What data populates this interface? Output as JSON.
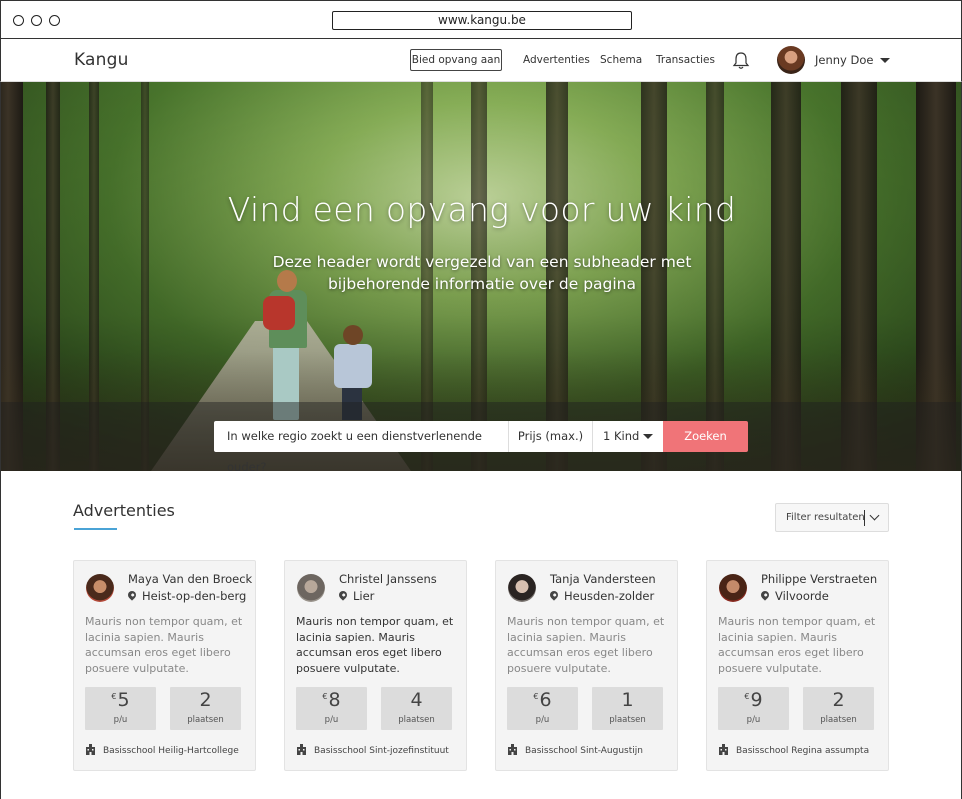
{
  "browser": {
    "url": "www.kangu.be"
  },
  "nav": {
    "logo": "Kangu",
    "offer_button": "Bied opvang aan",
    "links": [
      "Advertenties",
      "Schema",
      "Transacties"
    ],
    "user_name": "Jenny Doe"
  },
  "hero": {
    "title": "Vind een opvang voor uw kind",
    "subtitle_line1": "Deze header wordt vergezeld van een subheader met",
    "subtitle_line2": "bijbehorende informatie over de pagina"
  },
  "search": {
    "region_placeholder": "In welke regio zoekt u een dienstverlenende ouder?",
    "price_label": "Prijs (max.)",
    "kids_value": "1 Kind",
    "button": "Zoeken"
  },
  "section": {
    "title": "Advertenties",
    "filter_label": "Filter resultaten"
  },
  "cards": [
    {
      "name": "Maya Van den Broeck",
      "location": "Heist-op-den-berg",
      "description": "Mauris non tempor quam, et lacinia sapien. Mauris accumsan eros eget libero posuere vulputate.",
      "currency": "€",
      "price": "5",
      "price_unit": "p/u",
      "places": "2",
      "places_label": "plaatsen",
      "school": "Basisschool Heilig-Hartcollege"
    },
    {
      "name": "Christel Janssens",
      "location": "Lier",
      "description": "Mauris non tempor quam, et lacinia sapien. Mauris accumsan eros eget libero posuere vulputate.",
      "currency": "€",
      "price": "8",
      "price_unit": "p/u",
      "places": "4",
      "places_label": "plaatsen",
      "school": "Basisschool Sint-jozefinstituut"
    },
    {
      "name": "Tanja Vandersteen",
      "location": "Heusden-zolder",
      "description": "Mauris non tempor quam, et lacinia sapien. Mauris accumsan eros eget libero posuere vulputate.",
      "currency": "€",
      "price": "6",
      "price_unit": "p/u",
      "places": "1",
      "places_label": "plaatsen",
      "school": "Basisschool Sint-Augustijn"
    },
    {
      "name": "Philippe Verstraeten",
      "location": "Vilvoorde",
      "description": "Mauris non tempor quam, et lacinia sapien. Mauris accumsan eros eget libero posuere vulputate.",
      "currency": "€",
      "price": "9",
      "price_unit": "p/u",
      "places": "2",
      "places_label": "plaatsen",
      "school": "Basisschool Regina assumpta"
    }
  ],
  "colors": {
    "accent": "#f07478",
    "underline": "#4aa3d6"
  }
}
